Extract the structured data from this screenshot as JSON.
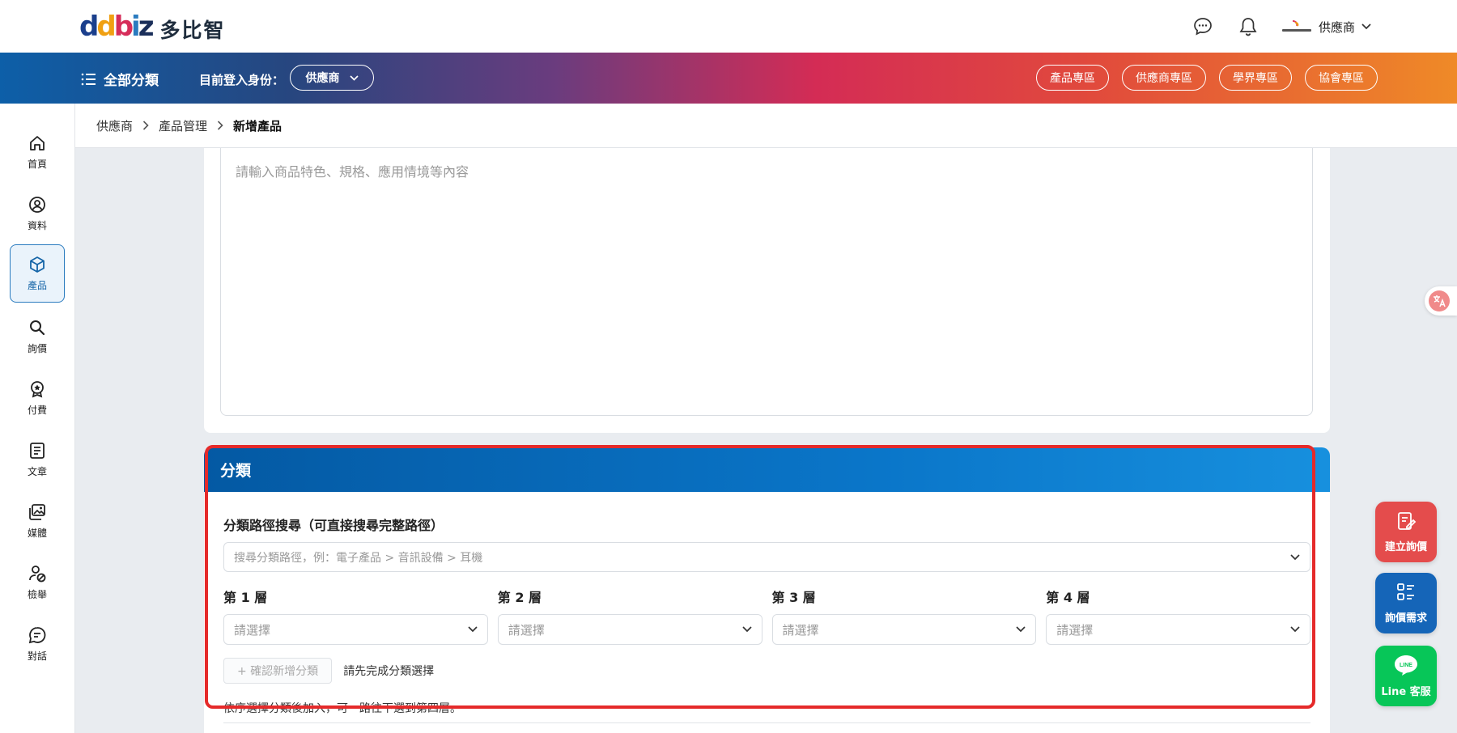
{
  "brand": {
    "logo_text": "多比智"
  },
  "header": {
    "user_name": "供應商"
  },
  "navbar": {
    "all_categories": "全部分類",
    "role_label": "目前登入身份：",
    "role_value": "供應商",
    "zones": [
      "產品專區",
      "供應商專區",
      "學界專區",
      "協會專區"
    ]
  },
  "sidebar": {
    "items": [
      {
        "label": "首頁",
        "icon": "home-icon"
      },
      {
        "label": "資料",
        "icon": "user-circle-icon"
      },
      {
        "label": "產品",
        "icon": "box-icon"
      },
      {
        "label": "詢價",
        "icon": "search-icon"
      },
      {
        "label": "付費",
        "icon": "badge-icon"
      },
      {
        "label": "文章",
        "icon": "document-icon"
      },
      {
        "label": "媒體",
        "icon": "images-icon"
      },
      {
        "label": "檢舉",
        "icon": "report-user-icon"
      },
      {
        "label": "對話",
        "icon": "chat-icon"
      }
    ],
    "active": "產品"
  },
  "breadcrumb": {
    "items": [
      "供應商",
      "產品管理",
      "新增產品"
    ]
  },
  "description": {
    "placeholder": "請輸入商品特色、規格、應用情境等內容"
  },
  "category": {
    "title": "分類",
    "path_label": "分類路徑搜尋（可直接搜尋完整路徑）",
    "path_placeholder": "搜尋分類路徑，例：電子產品 > 音訊設備 > 耳機",
    "layers": [
      {
        "label": "第 1 層",
        "placeholder": "請選擇"
      },
      {
        "label": "第 2 層",
        "placeholder": "請選擇"
      },
      {
        "label": "第 3 層",
        "placeholder": "請選擇"
      },
      {
        "label": "第 4 層",
        "placeholder": "請選擇"
      }
    ],
    "confirm_button": "+ 確認新增分類",
    "confirm_hint": "請先完成分類選擇",
    "note": "依序選擇分類後加入，可一路往下選到第四層。"
  },
  "floating": {
    "create_inquiry": "建立詢價",
    "inquiry_needs": "詢價需求",
    "line_service": "Line 客服",
    "line_logo": "LINE"
  },
  "colors": {
    "accent_blue": "#0a76c9",
    "highlight_red": "#e52a2a",
    "line_green": "#07c658"
  }
}
